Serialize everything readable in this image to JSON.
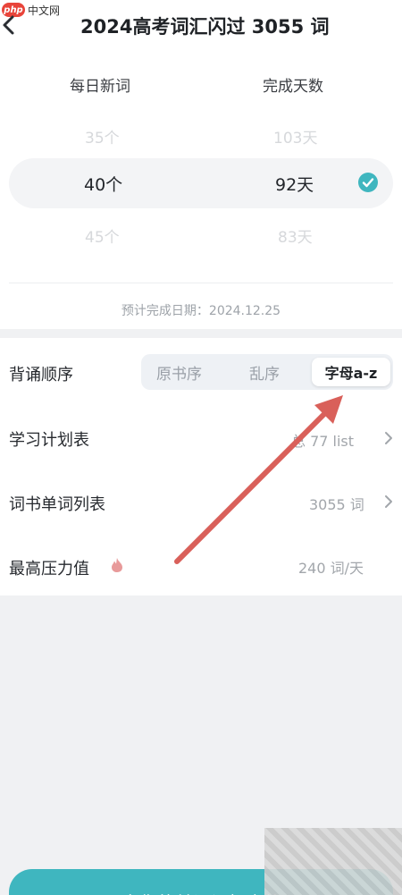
{
  "watermark": {
    "logo": "php",
    "text": "中文网"
  },
  "header": {
    "title": "2024高考词汇闪过 3055 词"
  },
  "plan_picker": {
    "daily_new_header": "每日新词",
    "days_header": "完成天数",
    "options_above": {
      "count": "35个",
      "days": "103天"
    },
    "selected": {
      "count": "40个",
      "days": "92天"
    },
    "options_below": {
      "count": "45个",
      "days": "83天"
    },
    "finish_date": "预计完成日期：2024.12.25"
  },
  "settings": {
    "order": {
      "label": "背诵顺序",
      "options": [
        "原书序",
        "乱序",
        "字母a-z"
      ],
      "selected": "字母a-z"
    },
    "study_plan": {
      "label": "学习计划表",
      "value": "总 77 list"
    },
    "word_list": {
      "label": "词书单词列表",
      "value": "3055 词"
    },
    "max_pressure": {
      "label": "最高压力值",
      "value": "240 词/天"
    }
  },
  "bottom": {
    "start_button": "开启你的单词记忆之旅"
  },
  "colors": {
    "accent": "#3fb6bf",
    "arrow": "#d9605a",
    "check": "#3fb6bf"
  }
}
